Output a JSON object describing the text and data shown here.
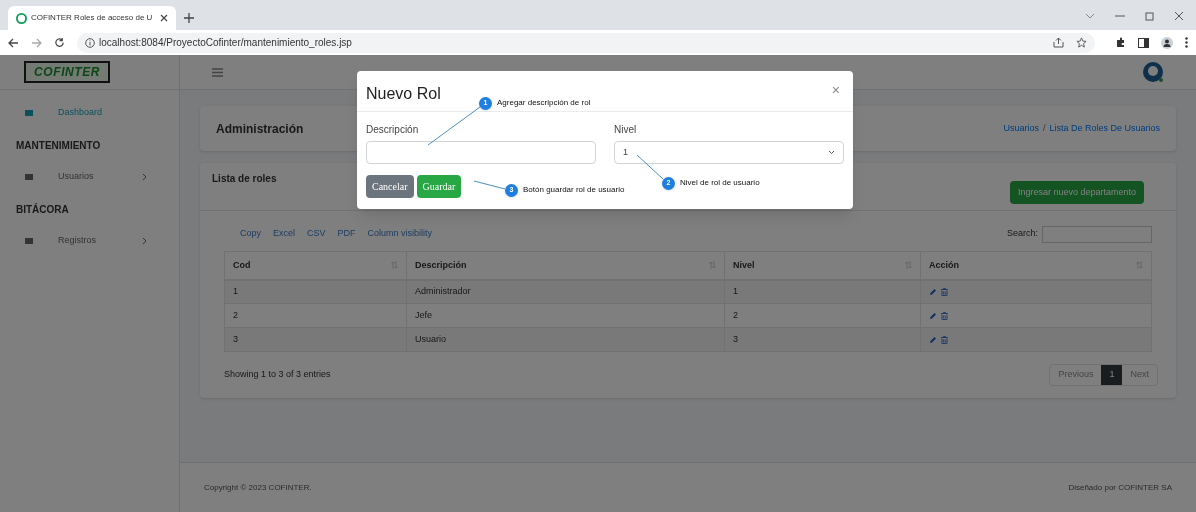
{
  "browser": {
    "tab_title": "COFINTER Roles de acceso de U",
    "url": "localhost:8084/ProyectoCofinter/mantenimiento_roles.jsp"
  },
  "sidebar": {
    "logo": "COFINTER",
    "items": [
      {
        "kind": "link",
        "label": "Dashboard",
        "selected": true,
        "expandable": false
      },
      {
        "kind": "section",
        "label": "MANTENIMIENTO"
      },
      {
        "kind": "link",
        "label": "Usuarios",
        "selected": false,
        "expandable": true
      },
      {
        "kind": "section",
        "label": "BITÁCORA"
      },
      {
        "kind": "link",
        "label": "Registros",
        "selected": false,
        "expandable": true
      }
    ]
  },
  "page_header": {
    "title": "Administración",
    "breadcrumb": {
      "items": [
        "Usuarios",
        "Lista De Roles De Usuarios"
      ],
      "separator": "/"
    }
  },
  "card": {
    "title": "Lista de roles",
    "button": "Ingresar nuevo departamento"
  },
  "table": {
    "export_buttons": [
      "Copy",
      "Excel",
      "CSV",
      "PDF",
      "Column visibility"
    ],
    "search_label": "Search:",
    "columns": [
      {
        "label": "Cod",
        "sortable": true
      },
      {
        "label": "Descripción",
        "sortable": true
      },
      {
        "label": "Nivel",
        "sortable": true
      },
      {
        "label": "Acción",
        "sortable": true
      }
    ],
    "rows": [
      {
        "cells": [
          "1",
          "Administrador",
          "1"
        ]
      },
      {
        "cells": [
          "2",
          "Jefe",
          "2"
        ]
      },
      {
        "cells": [
          "3",
          "Usuario",
          "3"
        ]
      }
    ],
    "info": "Showing 1 to 3 of 3 entries",
    "pagination": {
      "previous": "Previous",
      "pages": [
        {
          "label": "1",
          "selected": true
        }
      ],
      "next": "Next"
    }
  },
  "footer": {
    "left": "Copyright © 2023 COFINTER.",
    "right": "Diseñado por COFINTER SA"
  },
  "modal": {
    "title": "Nuevo Rol",
    "close": "×",
    "fields": [
      {
        "kind": "text",
        "label": "Descripción"
      },
      {
        "kind": "select",
        "label": "Nivel",
        "value": "1"
      }
    ],
    "buttons": [
      {
        "kind": "secondary",
        "label": "Cancelar"
      },
      {
        "kind": "primary",
        "label": "Guardar"
      }
    ]
  },
  "annotations": [
    {
      "number": "1",
      "text": "Agregar descripción de rol"
    },
    {
      "number": "2",
      "text": "Nivel de rol de usuario"
    },
    {
      "number": "3",
      "text": "Botón guardar rol de usuario"
    }
  ]
}
